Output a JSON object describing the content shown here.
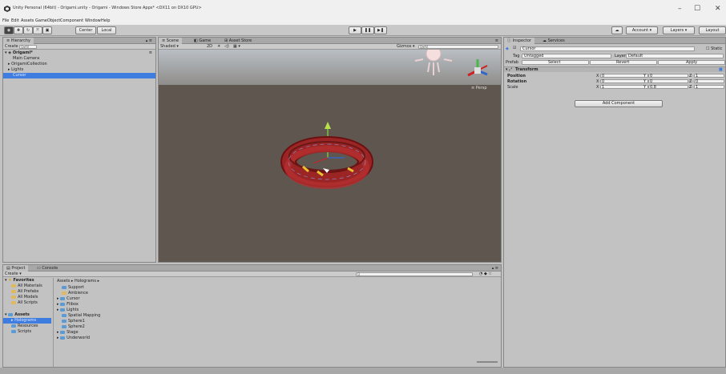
{
  "window": {
    "title": "Unity Personal (64bit) - Origami.unity - Origami - Windows Store Apps* <DX11 on DX10 GPU>",
    "minimize": "–",
    "maximize": "☐",
    "close": "✕"
  },
  "menu": [
    "File",
    "Edit",
    "Assets",
    "GameObject",
    "Component",
    "Window",
    "Help"
  ],
  "toolbar": {
    "pivot": "Center",
    "space": "Local",
    "play": "▶",
    "pause": "❚❚",
    "step": "▶❚",
    "account": "Account",
    "layers": "Layers",
    "layout": "Layout"
  },
  "hierarchy": {
    "tab": "Hierarchy",
    "create": "Create",
    "search_placeholder": "Q▾All",
    "scene": "Origami*",
    "items": [
      "Main Camera",
      "OrigamiCollection",
      "Lights",
      "Cursor"
    ]
  },
  "scene_view": {
    "tabs": [
      "Scene",
      "Game",
      "Asset Store"
    ],
    "shading": "Shaded",
    "mode": "2D",
    "gizmos": "Gizmos",
    "search_placeholder": "Q▾All",
    "persp_label": "≡ Persp"
  },
  "inspector": {
    "tabs": [
      "Inspector",
      "Services"
    ],
    "object_name": "Cursor",
    "static_label": "Static",
    "tag_label": "Tag",
    "tag_value": "Untagged",
    "layer_label": "Layer",
    "layer_value": "Default",
    "prefab_label": "Prefab",
    "prefab_select": "Select",
    "prefab_revert": "Revert",
    "prefab_apply": "Apply",
    "component": "Transform",
    "rows": [
      {
        "label": "Position",
        "x": "0",
        "y": "0",
        "z": "1"
      },
      {
        "label": "Rotation",
        "x": "0",
        "y": "0",
        "z": "0"
      },
      {
        "label": "Scale",
        "x": "1",
        "y": "0.8",
        "z": "1"
      }
    ],
    "add_component": "Add Component"
  },
  "project": {
    "tabs": [
      "Project",
      "Console"
    ],
    "create": "Create",
    "favorites_header": "Favorites",
    "favorites": [
      "All Materials",
      "All Prefabs",
      "All Models",
      "All Scripts"
    ],
    "assets_header": "Assets",
    "assets_tree": [
      "Holograms",
      "Resources",
      "Scripts"
    ],
    "breadcrumb": "Assets ▸ Holograms ▸",
    "items": [
      "Support",
      "Ambience",
      "Cursor",
      "Flibox",
      "Lights",
      "Spatial Mapping",
      "Sphere1",
      "Sphere2",
      "Stage",
      "Underworld"
    ],
    "search_placeholder": "Q"
  },
  "colors": {
    "scene_bg": "#5f5650",
    "sky": "#b5bac0",
    "selection": "#3e7ce0",
    "ring_red": "#8a1a1a"
  }
}
